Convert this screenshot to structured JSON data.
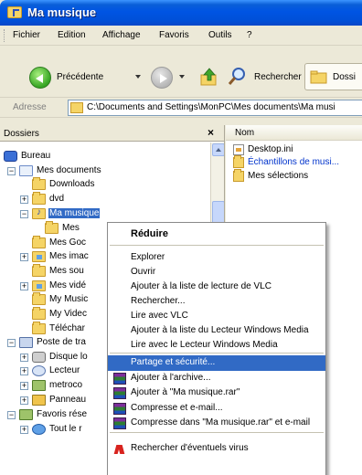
{
  "window": {
    "title": "Ma musique",
    "title_icon": "music-folder-icon"
  },
  "menubar": {
    "items": [
      "Fichier",
      "Edition",
      "Affichage",
      "Favoris",
      "Outils",
      "?"
    ]
  },
  "toolbar": {
    "back_label": "Précédente",
    "search_label": "Rechercher",
    "folders_label": "Dossi"
  },
  "address": {
    "label": "Adresse",
    "path": "C:\\Documents and Settings\\MonPC\\Mes documents\\Ma musi"
  },
  "tree": {
    "title": "Dossiers",
    "close_glyph": "×",
    "nodes": [
      {
        "label": "Bureau",
        "icon": "desktop-icon",
        "expander": ""
      },
      {
        "label": "Mes documents",
        "icon": "documents-folder-icon",
        "expander": "−"
      },
      {
        "label": "Downloads",
        "icon": "folder-icon",
        "expander": ""
      },
      {
        "label": "dvd",
        "icon": "folder-icon",
        "expander": "+"
      },
      {
        "label": "Ma musique",
        "icon": "music-folder-icon",
        "expander": "−",
        "selected": true
      },
      {
        "label": "Mes",
        "icon": "folder-icon",
        "expander": ""
      },
      {
        "label": "Mes Goc",
        "icon": "folder-icon",
        "expander": ""
      },
      {
        "label": "Mes imac",
        "icon": "pictures-folder-icon",
        "expander": "+"
      },
      {
        "label": "Mes sou",
        "icon": "folder-icon",
        "expander": ""
      },
      {
        "label": "Mes vidé",
        "icon": "videos-folder-icon",
        "expander": "+"
      },
      {
        "label": "My Music",
        "icon": "folder-icon",
        "expander": ""
      },
      {
        "label": "My Videc",
        "icon": "folder-icon",
        "expander": ""
      },
      {
        "label": "Téléchar",
        "icon": "folder-icon",
        "expander": ""
      },
      {
        "label": "Poste de tra",
        "icon": "computer-icon",
        "expander": "−"
      },
      {
        "label": "Disque lo",
        "icon": "hard-drive-icon",
        "expander": "+"
      },
      {
        "label": "Lecteur",
        "icon": "cd-drive-icon",
        "expander": "+"
      },
      {
        "label": "metroco",
        "icon": "network-drive-icon",
        "expander": "+"
      },
      {
        "label": "Panneau",
        "icon": "control-panel-icon",
        "expander": "+"
      },
      {
        "label": "Favoris rése",
        "icon": "network-places-icon",
        "expander": "−"
      },
      {
        "label": "Tout le r",
        "icon": "globe-icon",
        "expander": "+"
      }
    ]
  },
  "list": {
    "column_name": "Nom",
    "items": [
      {
        "label": "Desktop.ini",
        "icon": "ini-file-icon",
        "link": false
      },
      {
        "label": "Échantillons de musi...",
        "icon": "shortcut-folder-icon",
        "link": true
      },
      {
        "label": "Mes sélections",
        "icon": "folder-icon",
        "link": false
      }
    ]
  },
  "context_menu": {
    "items": [
      {
        "label": "Réduire",
        "bold": true
      },
      {
        "label": "Explorer"
      },
      {
        "label": "Ouvrir"
      },
      {
        "label": "Ajouter à la liste de lecture de VLC"
      },
      {
        "label": "Rechercher..."
      },
      {
        "label": "Lire avec VLC"
      },
      {
        "label": "Ajouter à la liste du Lecteur Windows Media"
      },
      {
        "label": "Lire avec le Lecteur Windows Media"
      },
      {
        "label": "Partage et sécurité...",
        "highlight": true
      },
      {
        "label": "Ajouter à l'archive...",
        "icon": "winrar-icon"
      },
      {
        "label": "Ajouter à \"Ma musique.rar\"",
        "icon": "winrar-icon"
      },
      {
        "label": "Compresse et e-mail...",
        "icon": "winrar-icon"
      },
      {
        "label": "Compresse dans \"Ma musique.rar\" et e-mail",
        "icon": "winrar-icon"
      },
      {
        "label": "Rechercher d'éventuels virus",
        "icon": "antivirus-icon"
      }
    ]
  },
  "colors": {
    "titlebar": "#0054e3",
    "selection": "#316ac5",
    "link": "#0033cc"
  }
}
